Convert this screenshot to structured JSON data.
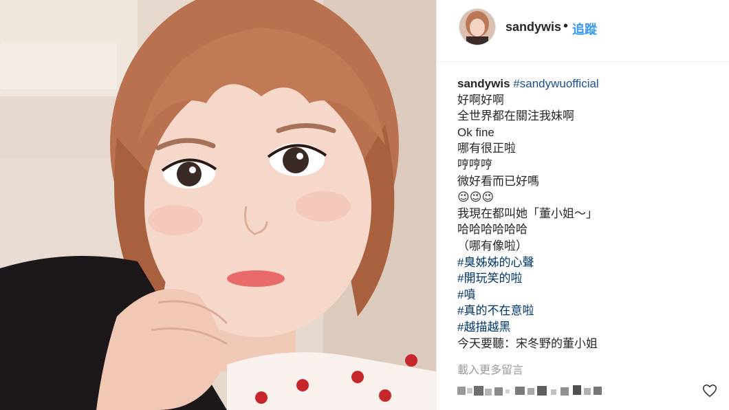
{
  "header": {
    "username": "sandywis",
    "separator": "•",
    "follow_label": "追蹤"
  },
  "caption": {
    "username": "sandywis",
    "main_tag": "#sandywuofficial",
    "lines": [
      "好啊好啊",
      "全世界都在關注我妹啊",
      "Ok fine",
      "哪有很正啦",
      "哼哼哼",
      "微好看而已好嗎",
      "😉😉😉",
      "我現在都叫她「董小姐～」",
      "哈哈哈哈哈哈",
      "（哪有像啦）",
      "#臭姊姊的心聲",
      "#開玩笑的啦",
      "#噴",
      "#真的不在意啦",
      "#越描越黑",
      "今天要聽：宋冬野的董小姐"
    ]
  },
  "comments": {
    "load_more_label": "載入更多留言"
  },
  "icons": {
    "heart": "heart-icon",
    "avatar": "avatar"
  },
  "colors": {
    "link": "#3897f0",
    "hashtag": "#003569",
    "text": "#262626",
    "muted": "#999999"
  }
}
